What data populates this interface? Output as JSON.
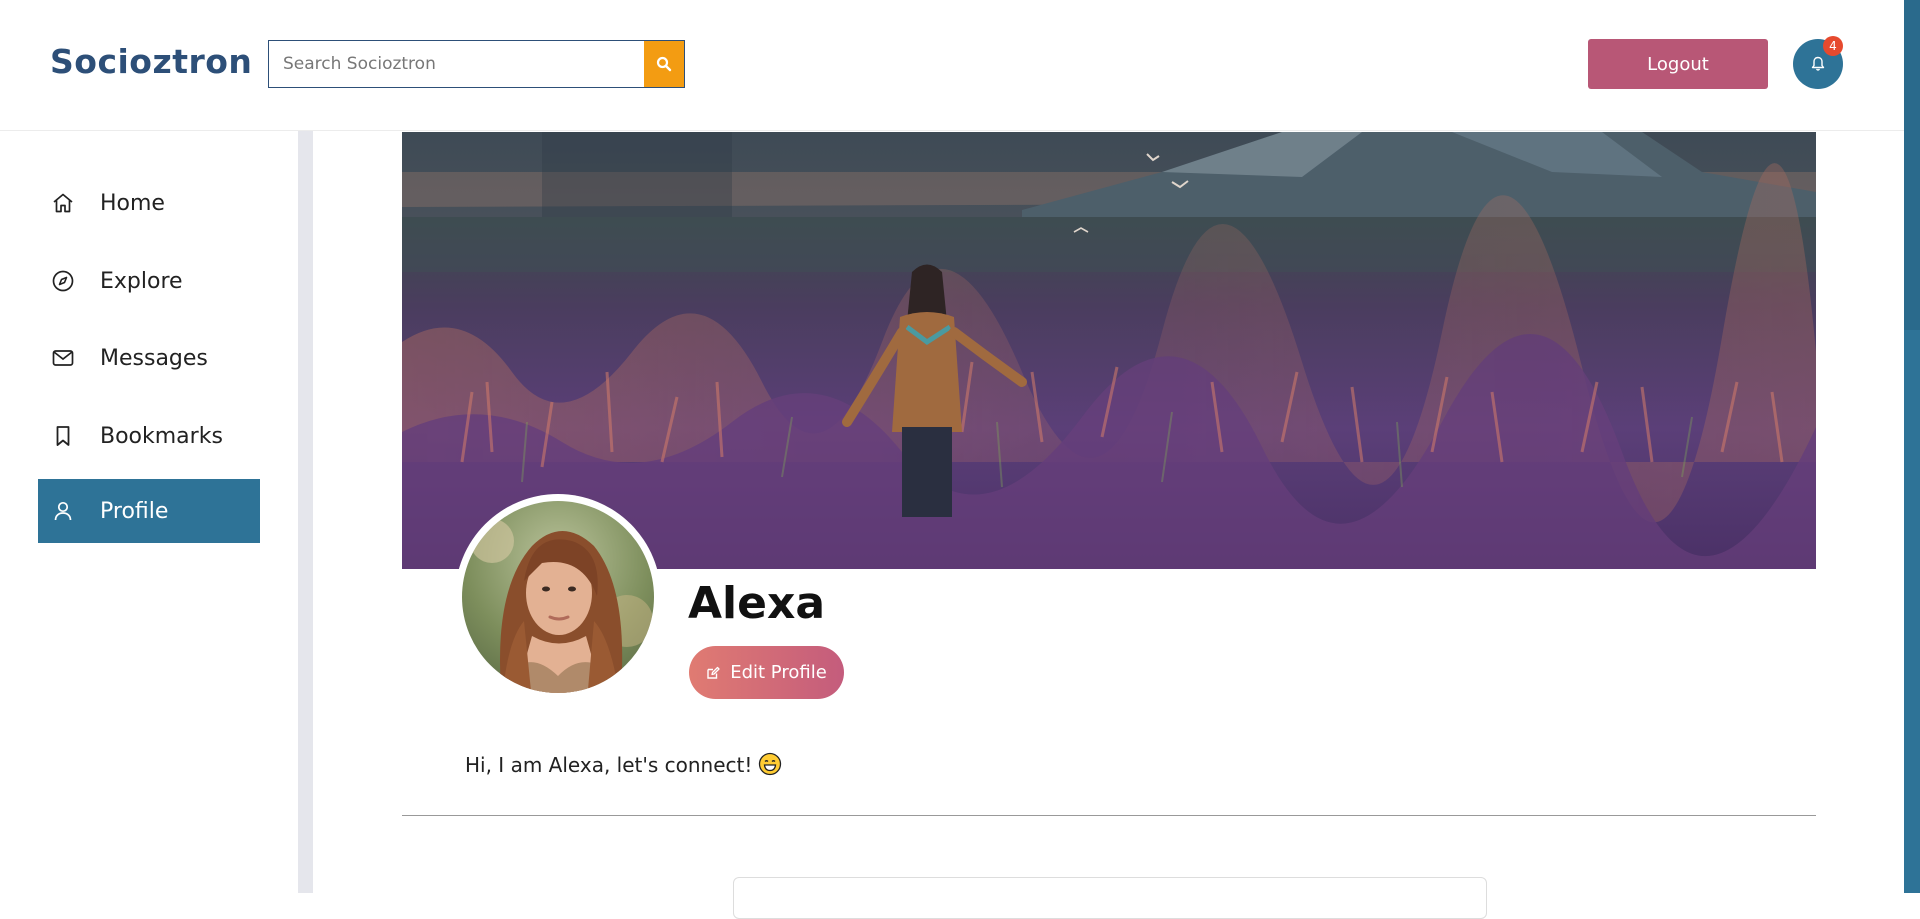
{
  "header": {
    "brand": "Socioztron",
    "search_placeholder": "Search Socioztron",
    "logout_label": "Logout",
    "notification_count": "4"
  },
  "sidebar": {
    "items": [
      {
        "label": "Home",
        "icon": "home-icon"
      },
      {
        "label": "Explore",
        "icon": "compass-icon"
      },
      {
        "label": "Messages",
        "icon": "mail-icon"
      },
      {
        "label": "Bookmarks",
        "icon": "bookmark-icon"
      },
      {
        "label": "Profile",
        "icon": "user-icon",
        "active": true
      }
    ]
  },
  "profile": {
    "name": "Alexa",
    "edit_label": "Edit Profile",
    "bio": "Hi, I am Alexa, let's connect!",
    "bio_emoji": "grinning-face-emoji"
  },
  "colors": {
    "brand": "#2d4f78",
    "accent": "#2e7397",
    "logout": "#b85776",
    "search_button": "#f39c12",
    "badge": "#e64a2e"
  }
}
